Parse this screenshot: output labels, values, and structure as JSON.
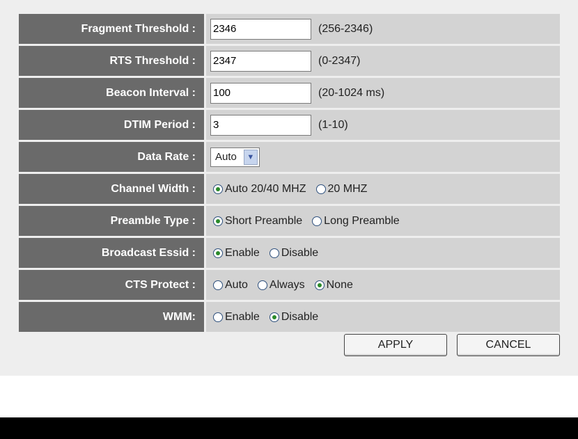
{
  "form": {
    "fragment_threshold": {
      "label": "Fragment Threshold :",
      "value": "2346",
      "hint": "(256-2346)"
    },
    "rts_threshold": {
      "label": "RTS Threshold :",
      "value": "2347",
      "hint": "(0-2347)"
    },
    "beacon_interval": {
      "label": "Beacon Interval :",
      "value": "100",
      "hint": "(20-1024 ms)"
    },
    "dtim_period": {
      "label": "DTIM Period :",
      "value": "3",
      "hint": "(1-10)"
    },
    "data_rate": {
      "label": "Data Rate :",
      "selected": "Auto"
    },
    "channel_width": {
      "label": "Channel Width :",
      "options": [
        "Auto 20/40 MHZ",
        "20 MHZ"
      ],
      "selected": "Auto 20/40 MHZ"
    },
    "preamble_type": {
      "label": "Preamble Type :",
      "options": [
        "Short Preamble",
        "Long Preamble"
      ],
      "selected": "Short Preamble"
    },
    "broadcast_essid": {
      "label": "Broadcast Essid :",
      "options": [
        "Enable",
        "Disable"
      ],
      "selected": "Enable"
    },
    "cts_protect": {
      "label": "CTS Protect :",
      "options": [
        "Auto",
        "Always",
        "None"
      ],
      "selected": "None"
    },
    "wmm": {
      "label": "WMM:",
      "options": [
        "Enable",
        "Disable"
      ],
      "selected": "Disable"
    }
  },
  "buttons": {
    "apply": "APPLY",
    "cancel": "CANCEL"
  },
  "colors": {
    "label_bg": "#6a6a6a",
    "value_bg": "#d3d3d3",
    "page_bg": "#eeeeee",
    "radio_dot": "#2a8a2a"
  },
  "icons": {
    "select_arrow": "chevron-down-icon",
    "radio": "radio-button-icon"
  }
}
